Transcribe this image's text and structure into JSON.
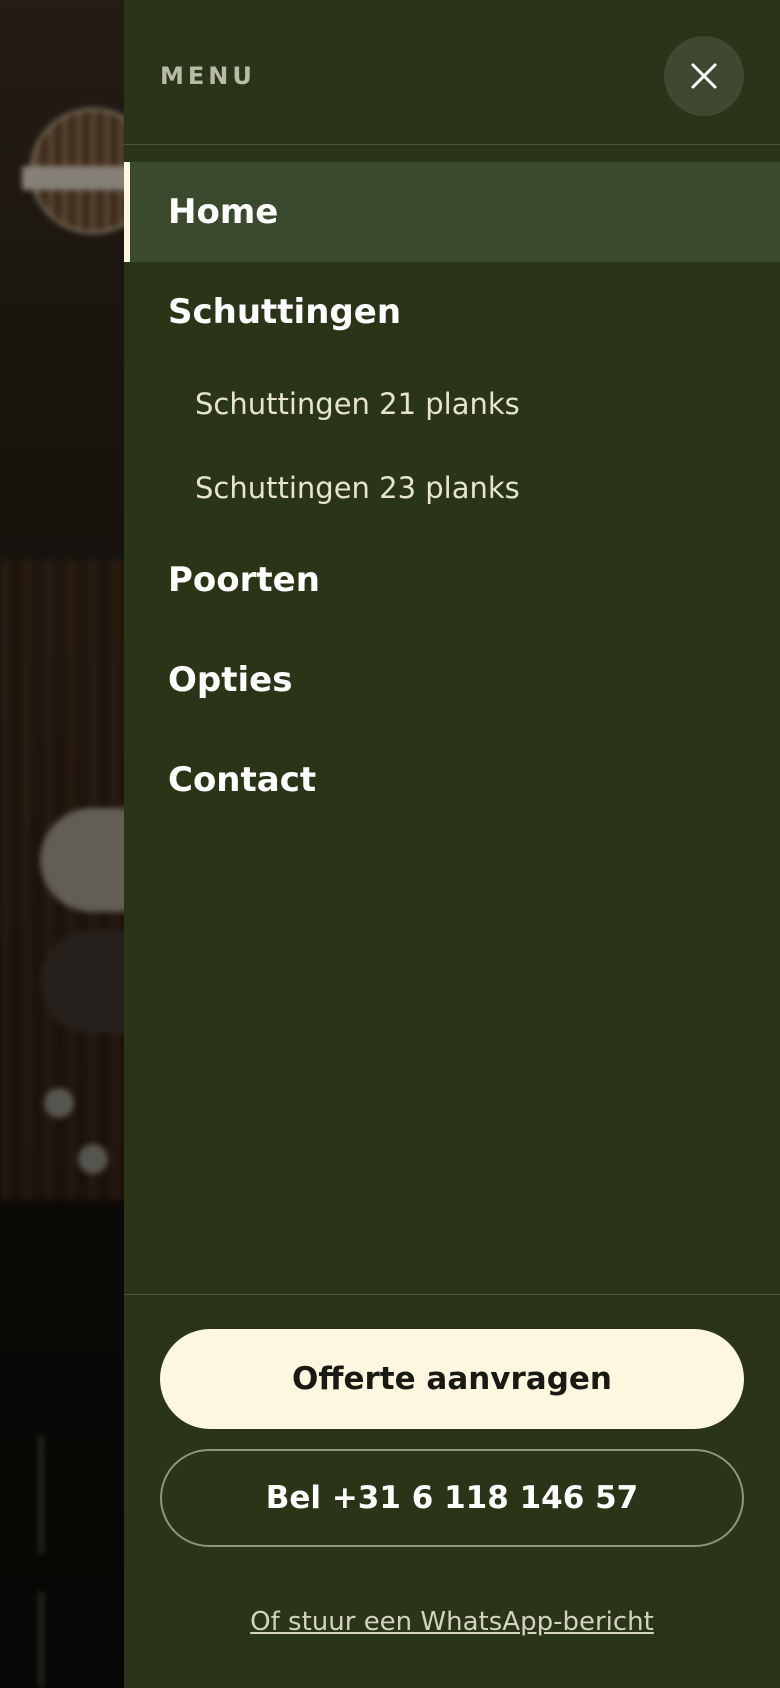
{
  "menu": {
    "title": "MENU",
    "close_icon": "close-icon"
  },
  "nav": {
    "items": [
      {
        "label": "Home",
        "active": true
      },
      {
        "label": "Schuttingen",
        "active": false
      },
      {
        "label": "Schuttingen 21 planks",
        "sub": true
      },
      {
        "label": "Schuttingen 23 planks",
        "sub": true
      },
      {
        "label": "Poorten",
        "active": false
      },
      {
        "label": "Opties",
        "active": false
      },
      {
        "label": "Contact",
        "active": false
      }
    ]
  },
  "footer": {
    "quote_label": "Offerte aanvragen",
    "call_label": "Bel +31 6 118 146 57",
    "whatsapp_label": "Of stuur een WhatsApp-bericht"
  },
  "colors": {
    "drawer_bg": "#2a3518",
    "active_bg": "#3a4a2c",
    "cream": "#fdf7df"
  }
}
